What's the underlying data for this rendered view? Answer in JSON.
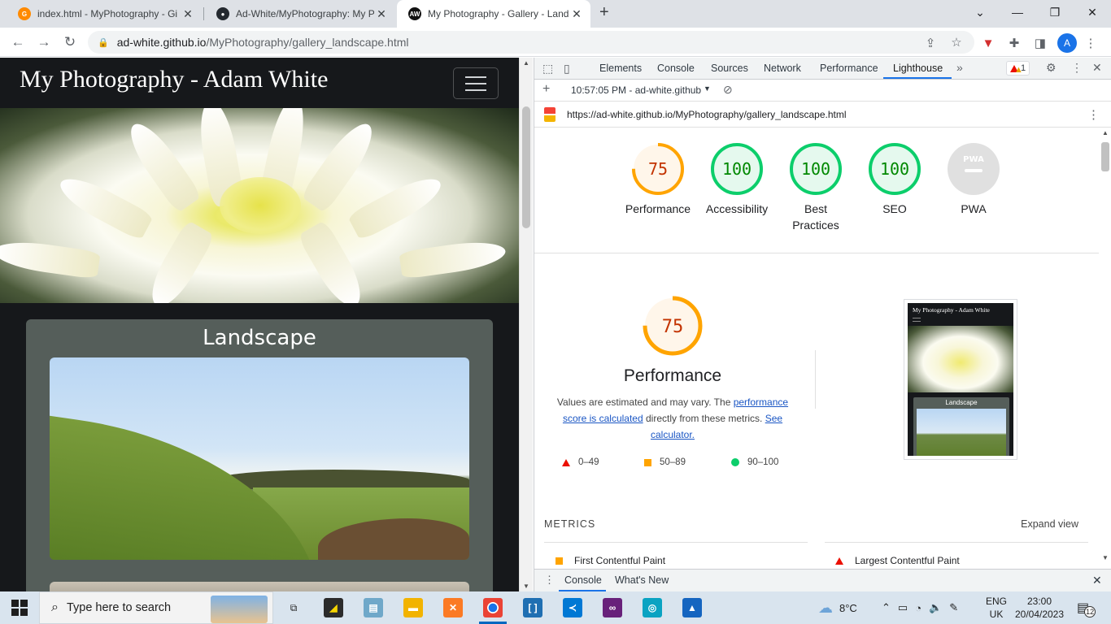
{
  "browser": {
    "tabs": [
      {
        "title": "index.html - MyPhotography - Gi",
        "favicon": "gitpod-icon",
        "color": "#ff8a00",
        "active": false
      },
      {
        "title": "Ad-White/MyPhotography: My P",
        "favicon": "github-icon",
        "color": "#24292f",
        "active": false
      },
      {
        "title": "My Photography - Gallery - Land",
        "favicon": "AW",
        "color": "#111111",
        "active": true
      }
    ],
    "url_host": "ad-white.github.io",
    "url_path": "/MyPhotography/gallery_landscape.html",
    "profile_initial": "A"
  },
  "site": {
    "brand": "My Photography - Adam White",
    "gallery_title": "Landscape"
  },
  "devtools": {
    "tabs": [
      "Elements",
      "Console",
      "Sources",
      "Network",
      "Performance",
      "Lighthouse"
    ],
    "selected_tab": "Lighthouse",
    "warning_count": "1",
    "report_select": "10:57:05 PM - ad-white.github",
    "report_url": "https://ad-white.github.io/MyPhotography/gallery_landscape.html",
    "scores": [
      {
        "label": "Performance",
        "value": 75,
        "display": "75",
        "color": "#ffa400",
        "fill": "#fff6ea",
        "text": "#c33300"
      },
      {
        "label": "Accessibility",
        "value": 100,
        "display": "100",
        "color": "#0cce6b",
        "fill": "#e5f9ee",
        "text": "#008800"
      },
      {
        "label": "Best Practices",
        "value": 100,
        "display": "100",
        "color": "#0cce6b",
        "fill": "#e5f9ee",
        "text": "#008800"
      },
      {
        "label": "SEO",
        "value": 100,
        "display": "100",
        "color": "#0cce6b",
        "fill": "#e5f9ee",
        "text": "#008800"
      },
      {
        "label": "PWA",
        "value": null,
        "display": "PWA",
        "color": "#e0e0e0",
        "fill": "#e0e0e0",
        "text": "#ffffff"
      }
    ],
    "performance": {
      "score": "75",
      "title": "Performance",
      "desc_1": "Values are estimated and may vary. The ",
      "desc_link_1": "performance score is calculated",
      "desc_2": " directly from these metrics. ",
      "desc_link_2": "See calculator.",
      "legend": [
        "0–49",
        "50–89",
        "90–100"
      ]
    },
    "screenshot": {
      "title": "My Photography - Adam White",
      "card": "Landscape"
    },
    "metrics_header": "METRICS",
    "expand_view": "Expand view",
    "metrics": [
      "First Contentful Paint",
      "Largest Contentful Paint"
    ],
    "drawer_tabs": [
      "Console",
      "What's New"
    ]
  },
  "taskbar": {
    "search_placeholder": "Type here to search",
    "weather": "8°C",
    "lang_1": "ENG",
    "lang_2": "UK",
    "time": "23:00",
    "date": "20/04/2023",
    "notifications": "12"
  }
}
